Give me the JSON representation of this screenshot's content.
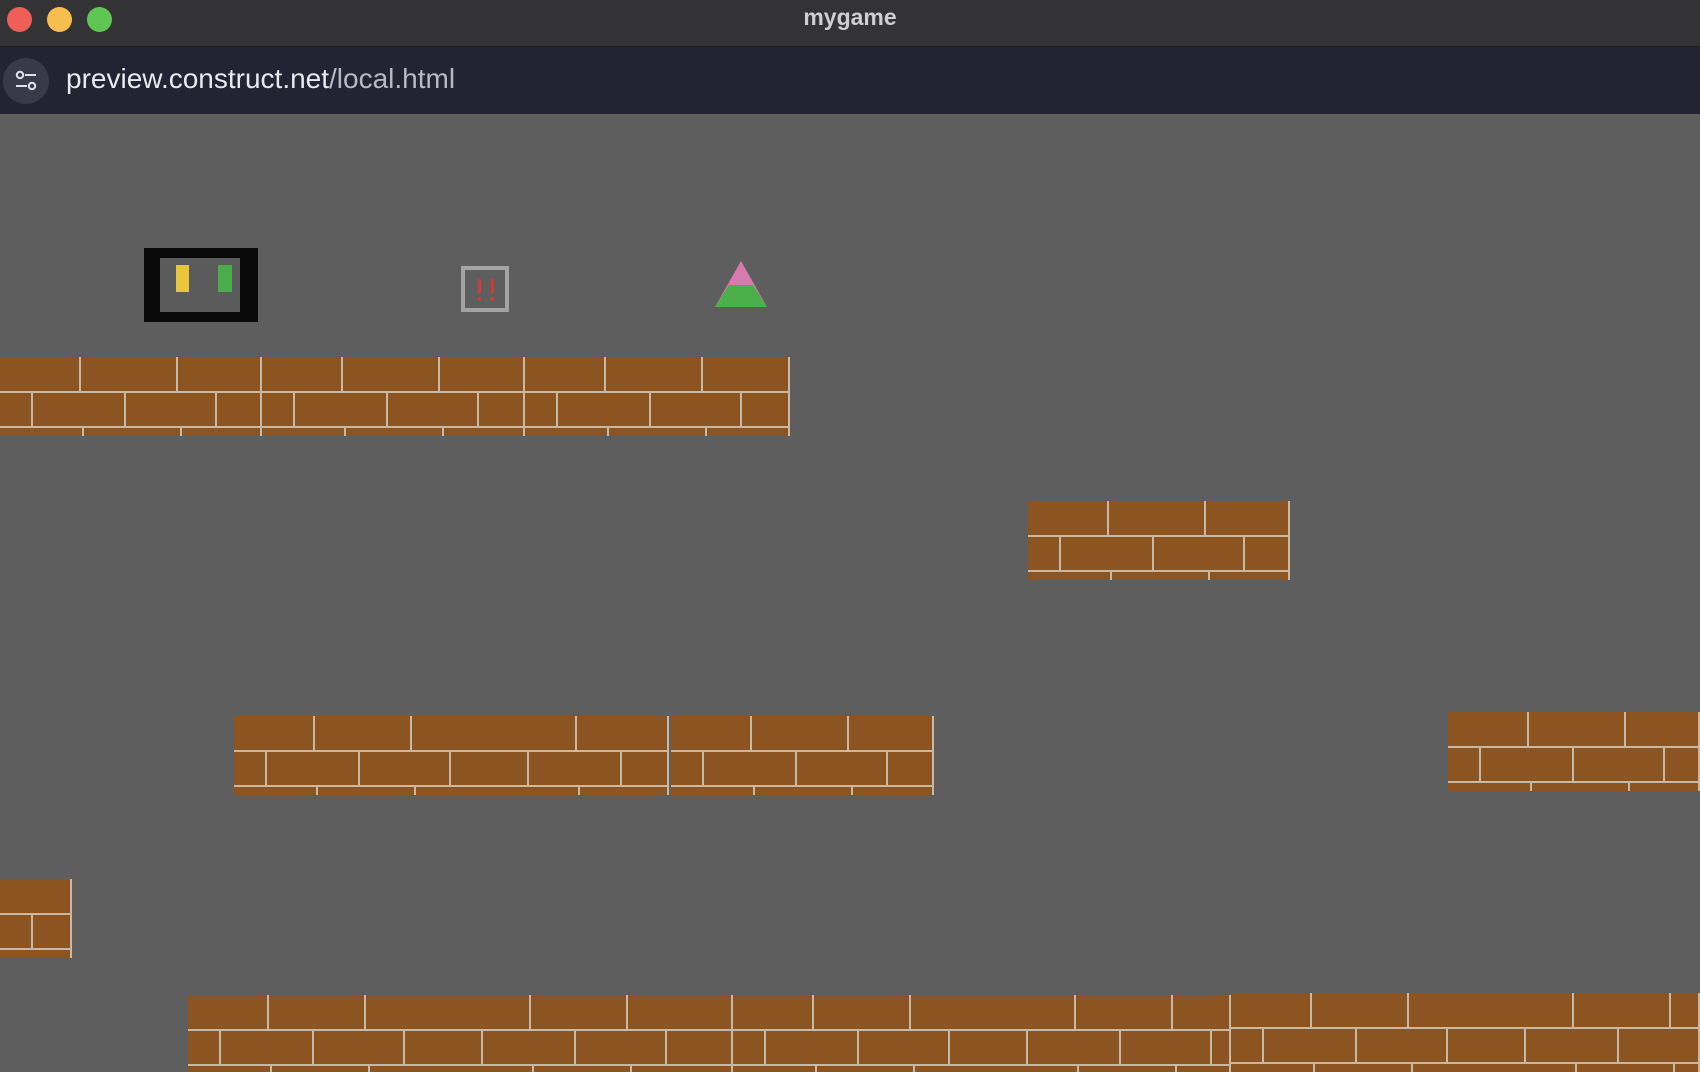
{
  "window": {
    "title": "mygame"
  },
  "address_bar": {
    "url_host": "preview.construct.net",
    "url_path": "/local.html",
    "settings_icon": "tune-sliders-icon"
  },
  "colors": {
    "background": "#5e5e5e",
    "brick": "#8c5420",
    "mortar": "#c9b8a3",
    "close": "#ee5f57",
    "minimize": "#f6be4f",
    "zoom": "#5fc553"
  },
  "sprites": {
    "health_box": {
      "left_bar_color": "#e8c53a",
      "right_bar_color": "#4aac4b"
    },
    "exclaim_box": {
      "mark_color": "#d23a3a"
    },
    "triangle": {
      "top_color": "#d77bb0",
      "bottom_color": "#4bb04a"
    }
  },
  "platform_count": 11
}
